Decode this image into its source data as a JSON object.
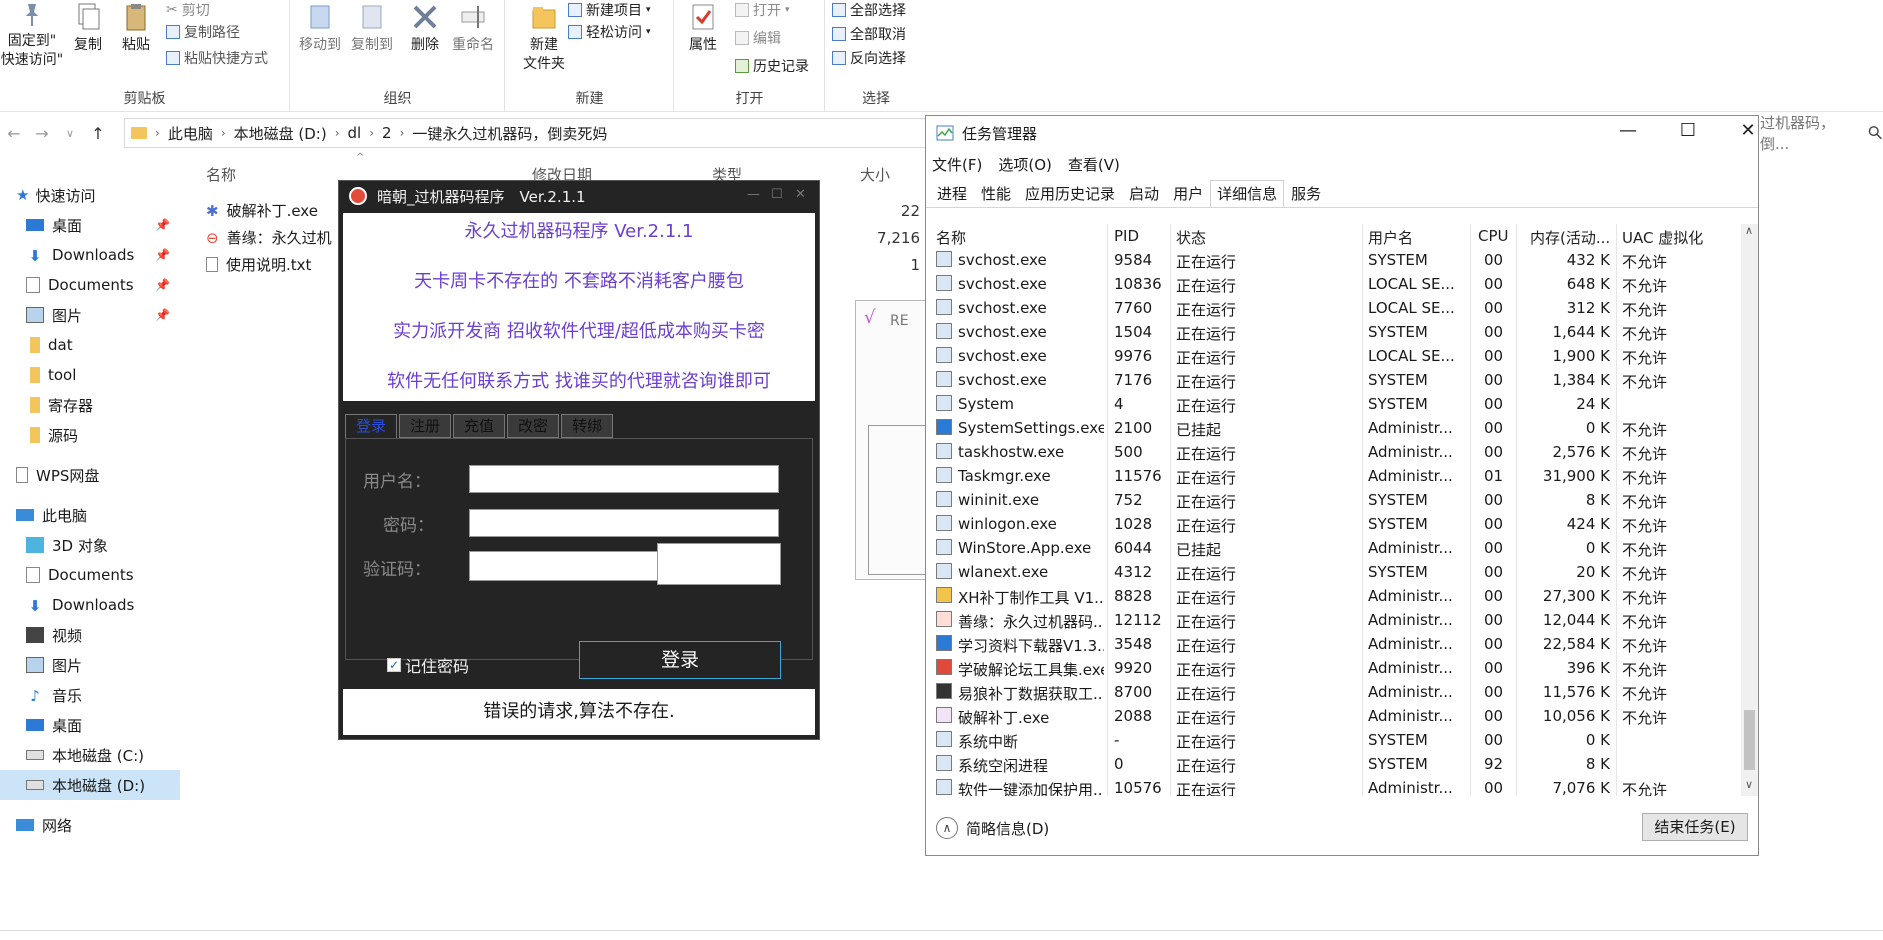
{
  "ribbon": {
    "clipboard": {
      "pin_label": "固定到\"\n快速访问\"",
      "copy": "复制",
      "paste": "粘贴",
      "cut": "剪切",
      "copy_path": "复制路径",
      "paste_shortcut": "粘贴快捷方式",
      "group": "剪贴板"
    },
    "organize": {
      "move_to": "移动到",
      "copy_to": "复制到",
      "delete": "删除",
      "rename": "重命名",
      "group": "组织"
    },
    "new": {
      "new_folder": "新建\n文件夹",
      "new_item": "新建项目",
      "easy_access": "轻松访问",
      "group": "新建"
    },
    "open": {
      "properties": "属性",
      "open": "打开",
      "edit": "编辑",
      "history": "历史记录",
      "group": "打开"
    },
    "select": {
      "select_all": "全部选择",
      "select_none": "全部取消",
      "invert": "反向选择",
      "group": "选择"
    }
  },
  "address": {
    "crumbs": [
      "此电脑",
      "本地磁盘 (D:)",
      "dl",
      "2",
      "一键永久过机器码，倒卖死妈"
    ],
    "search_tail": "过机器码，倒..."
  },
  "navpane": {
    "quick_access": "快速访问",
    "items": [
      "桌面",
      "Downloads",
      "Documents",
      "图片",
      "dat",
      "tool",
      "寄存器",
      "源码"
    ],
    "wps": "WPS网盘",
    "this_pc": "此电脑",
    "pc_items": [
      "3D 对象",
      "Documents",
      "Downloads",
      "视频",
      "图片",
      "音乐",
      "桌面",
      "本地磁盘 (C:)",
      "本地磁盘 (D:)"
    ],
    "network": "网络"
  },
  "filelist": {
    "columns": {
      "name": "名称",
      "date": "修改日期",
      "type": "类型",
      "size": "大小"
    },
    "files": [
      {
        "name": "破解补丁.exe",
        "size": "22"
      },
      {
        "name": "善缘：永久过机",
        "size": "7,216"
      },
      {
        "name": "使用说明.txt",
        "size": "1"
      }
    ],
    "ghost_label": "RE"
  },
  "dialog": {
    "title": "暗朝_过机器码程序　Ver.2.1.1",
    "banner": [
      "永久过机器码程序 Ver.2.1.1",
      "天卡周卡不存在的 不套路不消耗客户腰包",
      "实力派开发商 招收软件代理/超低成本购买卡密",
      "软件无任何联系方式 找谁买的代理就咨询谁即可"
    ],
    "tabs": [
      "登录",
      "注册",
      "充值",
      "改密",
      "转绑"
    ],
    "username_label": "用户名：",
    "password_label": "密码：",
    "captcha_label": "验证码：",
    "remember": "记住密码",
    "login": "登录",
    "status": "错误的请求,算法不存在."
  },
  "taskmgr": {
    "title": "任务管理器",
    "menu": [
      "文件(F)",
      "选项(O)",
      "查看(V)"
    ],
    "tabs": [
      "进程",
      "性能",
      "应用历史记录",
      "启动",
      "用户",
      "详细信息",
      "服务"
    ],
    "columns": [
      "名称",
      "PID",
      "状态",
      "用户名",
      "CPU",
      "内存(活动...",
      "UAC 虚拟化"
    ],
    "rows": [
      [
        "svchost.exe",
        "9584",
        "正在运行",
        "SYSTEM",
        "00",
        "432 K",
        "不允许"
      ],
      [
        "svchost.exe",
        "10836",
        "正在运行",
        "LOCAL SE...",
        "00",
        "648 K",
        "不允许"
      ],
      [
        "svchost.exe",
        "7760",
        "正在运行",
        "LOCAL SE...",
        "00",
        "312 K",
        "不允许"
      ],
      [
        "svchost.exe",
        "1504",
        "正在运行",
        "SYSTEM",
        "00",
        "1,644 K",
        "不允许"
      ],
      [
        "svchost.exe",
        "9976",
        "正在运行",
        "LOCAL SE...",
        "00",
        "1,900 K",
        "不允许"
      ],
      [
        "svchost.exe",
        "7176",
        "正在运行",
        "SYSTEM",
        "00",
        "1,384 K",
        "不允许"
      ],
      [
        "System",
        "4",
        "正在运行",
        "SYSTEM",
        "00",
        "24 K",
        ""
      ],
      [
        "SystemSettings.exe",
        "2100",
        "已挂起",
        "Administr...",
        "00",
        "0 K",
        "不允许"
      ],
      [
        "taskhostw.exe",
        "500",
        "正在运行",
        "Administr...",
        "00",
        "2,576 K",
        "不允许"
      ],
      [
        "Taskmgr.exe",
        "11576",
        "正在运行",
        "Administr...",
        "01",
        "31,900 K",
        "不允许"
      ],
      [
        "wininit.exe",
        "752",
        "正在运行",
        "SYSTEM",
        "00",
        "8 K",
        "不允许"
      ],
      [
        "winlogon.exe",
        "1028",
        "正在运行",
        "SYSTEM",
        "00",
        "424 K",
        "不允许"
      ],
      [
        "WinStore.App.exe",
        "6044",
        "已挂起",
        "Administr...",
        "00",
        "0 K",
        "不允许"
      ],
      [
        "wlanext.exe",
        "4312",
        "正在运行",
        "SYSTEM",
        "00",
        "20 K",
        "不允许"
      ],
      [
        "XH补丁制作工具 V1....",
        "8828",
        "正在运行",
        "Administr...",
        "00",
        "27,300 K",
        "不允许"
      ],
      [
        "善缘：永久过机器码....",
        "12112",
        "正在运行",
        "Administr...",
        "00",
        "12,044 K",
        "不允许"
      ],
      [
        "学习资料下载器V1.3....",
        "3548",
        "正在运行",
        "Administr...",
        "00",
        "22,584 K",
        "不允许"
      ],
      [
        "学破解论坛工具集.exe",
        "9920",
        "正在运行",
        "Administr...",
        "00",
        "396 K",
        "不允许"
      ],
      [
        "易狼补丁数据获取工...",
        "8700",
        "正在运行",
        "Administr...",
        "00",
        "11,576 K",
        "不允许"
      ],
      [
        "破解补丁.exe",
        "2088",
        "正在运行",
        "Administr...",
        "00",
        "10,056 K",
        "不允许"
      ],
      [
        "系统中断",
        "-",
        "正在运行",
        "SYSTEM",
        "00",
        "0 K",
        ""
      ],
      [
        "系统空闲进程",
        "0",
        "正在运行",
        "SYSTEM",
        "92",
        "8 K",
        ""
      ],
      [
        "软件一键添加保护用...",
        "10576",
        "正在运行",
        "Administr...",
        "00",
        "7,076 K",
        "不允许"
      ]
    ],
    "fewer_details": "简略信息(D)",
    "end_task": "结束任务(E)"
  },
  "colors": {
    "accent": "#6b3fd0",
    "selection": "#cce4f7",
    "dialog_bg": "#242424"
  }
}
